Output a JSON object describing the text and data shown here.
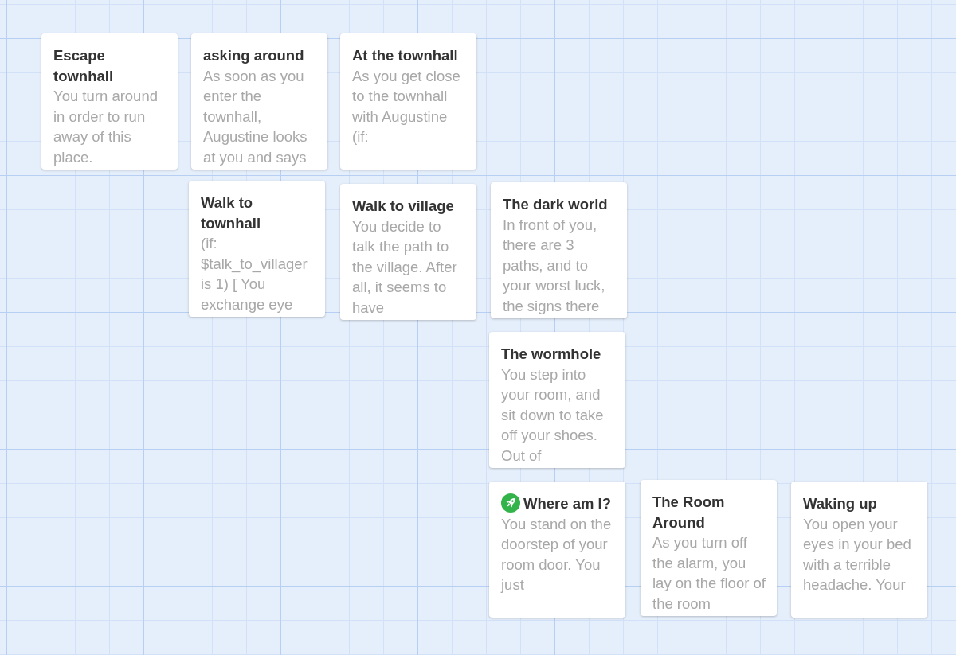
{
  "story_map": {
    "passages": [
      {
        "title": "Escape townhall",
        "excerpt": "You turn around in order to run away of this place.",
        "start": false
      },
      {
        "title": "asking around",
        "excerpt": "As soon as you enter the townhall, Augustine looks at you and says",
        "start": false
      },
      {
        "title": "At the townhall",
        "excerpt": "As you get close to the townhall with Augustine (if:",
        "start": false
      },
      {
        "title": "Walk to townhall",
        "excerpt": "(if: $talk_to_villager is 1) [ You exchange eye",
        "start": false
      },
      {
        "title": "Walk to village",
        "excerpt": "You decide to talk the path to the village. After all, it seems to have",
        "start": false
      },
      {
        "title": "The dark world",
        "excerpt": "In front of you, there are 3 paths, and to your worst luck, the signs there",
        "start": false
      },
      {
        "title": "The wormhole",
        "excerpt": "You step into your room, and sit down to take off your shoes. Out of",
        "start": false
      },
      {
        "title": "Where am I?",
        "excerpt": "You stand on the doorstep of your room door. You just",
        "start": true
      },
      {
        "title": "The Room Around",
        "excerpt": "As you turn off the alarm, you lay on the floor of the room",
        "start": false
      },
      {
        "title": "Waking up",
        "excerpt": "You open your eyes in your bed with a terrible headache. Your",
        "start": false
      }
    ]
  }
}
